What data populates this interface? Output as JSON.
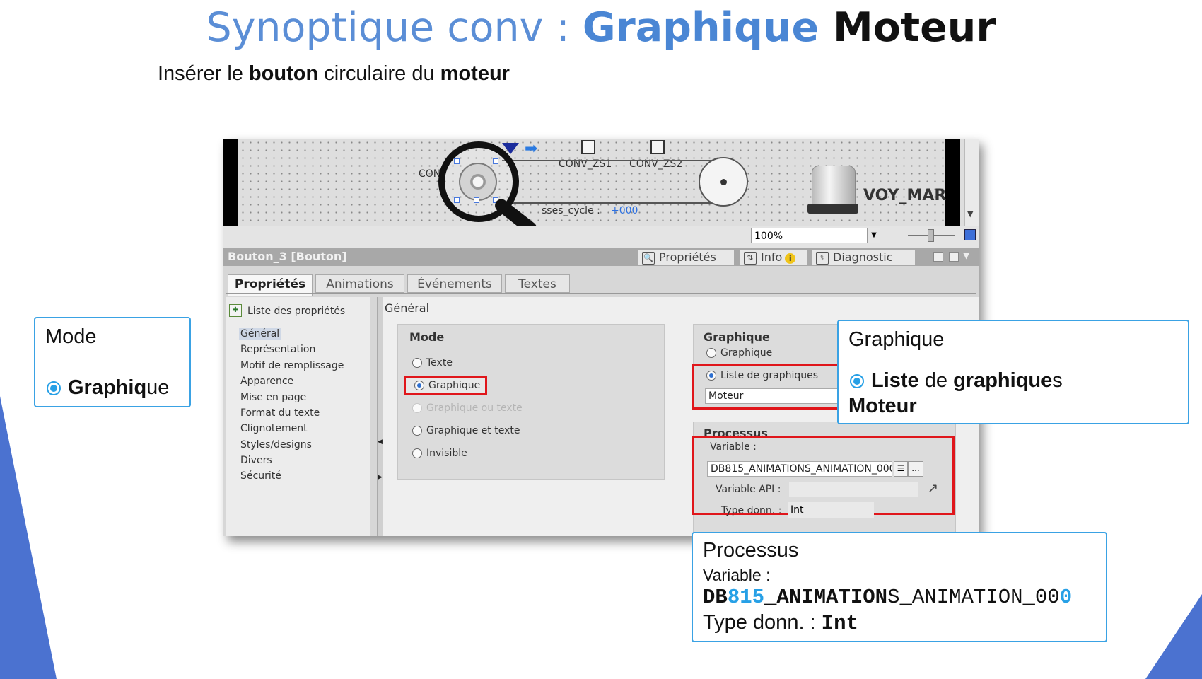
{
  "slide": {
    "title_part1": "Synoptique conv : ",
    "title_part2": "Graphique",
    "title_part3": " Moteur",
    "subtitle_part1": "Insérer le ",
    "subtitle_part2": "bouton",
    "subtitle_part3": " circulaire du ",
    "subtitle_part4": "moteur"
  },
  "canvas": {
    "label_conv_zs1": "CONV_ZS1",
    "label_conv_zs2": "CONV_ZS2",
    "label_conv_partial": "CON",
    "label_cycle": "sses_cycle :",
    "cycle_value": "+000",
    "label_voy_mar": "VOY_MAR",
    "zoom_value": "100%"
  },
  "inspector": {
    "title": "Bouton_3 [Bouton]",
    "header_tabs": [
      "Propriétés",
      "Info",
      "Diagnostic"
    ],
    "info_badge": "i",
    "sub_tabs": [
      "Propriétés",
      "Animations",
      "Événements",
      "Textes"
    ],
    "nav_header": "Liste des propriétés",
    "nav_items": [
      "Général",
      "Représentation",
      "Motif de remplissage",
      "Apparence",
      "Mise en page",
      "Format du texte",
      "Clignotement",
      "Styles/designs",
      "Divers",
      "Sécurité"
    ],
    "section_title": "Général",
    "mode": {
      "title": "Mode",
      "options": [
        "Texte",
        "Graphique",
        "Graphique ou texte",
        "Graphique et texte",
        "Invisible"
      ],
      "selected": "Graphique"
    },
    "graphique": {
      "title": "Graphique",
      "option_graphique": "Graphique",
      "option_liste": "Liste de graphiques",
      "list_value": "Moteur"
    },
    "processus": {
      "title": "Processus",
      "variable_label": "Variable :",
      "variable_value": "DB815_ANIMATIONS_ANIMATION_000",
      "browse_label": "...",
      "variable_api_label": "Variable API :",
      "type_label": "Type donn. :",
      "type_value": "Int"
    }
  },
  "callouts": {
    "mode_title": "Mode",
    "mode_value_a": "Graphiq",
    "mode_value_b": "ue",
    "graph_title": "Graphique",
    "graph_value_a": "Liste",
    "graph_value_b": " de ",
    "graph_value_c": "graphique",
    "graph_value_d": "s",
    "graph_value_e": "Moteur",
    "proc_title": "Processus",
    "proc_var_label": "Variable :",
    "proc_var_a": "DB",
    "proc_var_b": "815",
    "proc_var_c": "_ANIMATION",
    "proc_var_d": "S",
    "proc_var_e": "_ANIMATION_00",
    "proc_var_f": "0",
    "proc_type_label": "Type donn. : ",
    "proc_type_value": "Int"
  },
  "colors": {
    "accent_blue": "#4a86d4",
    "callout_border": "#3aa2e4",
    "highlight_red": "#e0161b"
  }
}
